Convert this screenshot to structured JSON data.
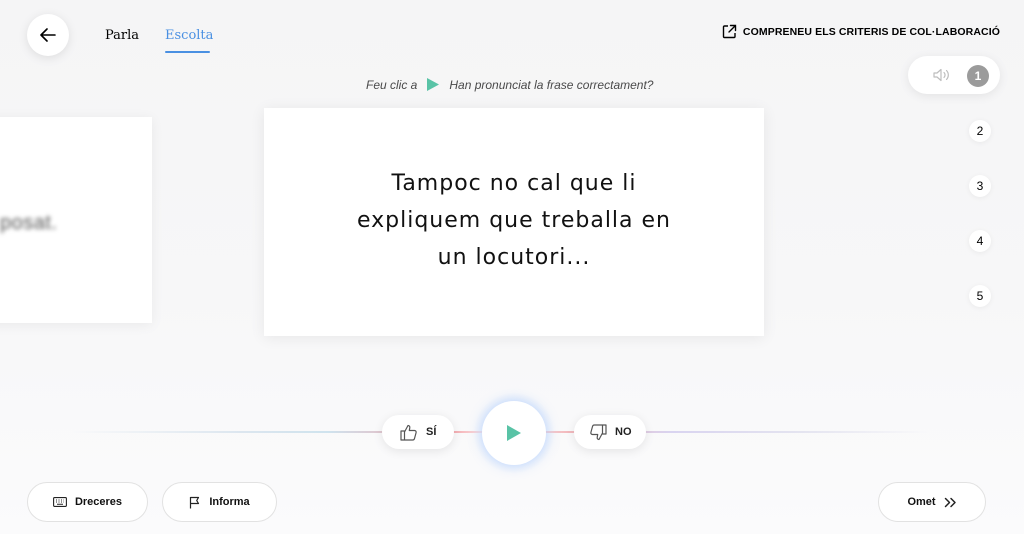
{
  "nav": {
    "tabs": [
      {
        "label": "Parla",
        "active": false
      },
      {
        "label": "Escolta",
        "active": true
      }
    ],
    "criteria_link": "COMPRENEU ELS CRITERIS DE COL·LABORACIÓ"
  },
  "instructions": {
    "part1": "Feu clic a",
    "part2": "Han pronunciat la frase correctament?"
  },
  "previous_card": {
    "text": "posat."
  },
  "current_card": {
    "sentence": "Tampoc no cal que li expliquem que treballa en un locutori..."
  },
  "progress": {
    "items": [
      "1",
      "2",
      "3",
      "4",
      "5"
    ],
    "current": "1"
  },
  "vote": {
    "yes_label": "SÍ",
    "no_label": "NO"
  },
  "footer": {
    "shortcuts_label": "Dreceres",
    "report_label": "Informa",
    "skip_label": "Omet"
  },
  "colors": {
    "accent_blue": "#4a90e2",
    "play_green": "#59c3a6",
    "active_step": "#9b9b9b"
  },
  "icons": [
    "back-arrow-icon",
    "external-link-icon",
    "play-icon",
    "speaker-icon",
    "thumbs-up-icon",
    "thumbs-down-icon",
    "keyboard-icon",
    "flag-icon",
    "skip-forward-icon"
  ]
}
